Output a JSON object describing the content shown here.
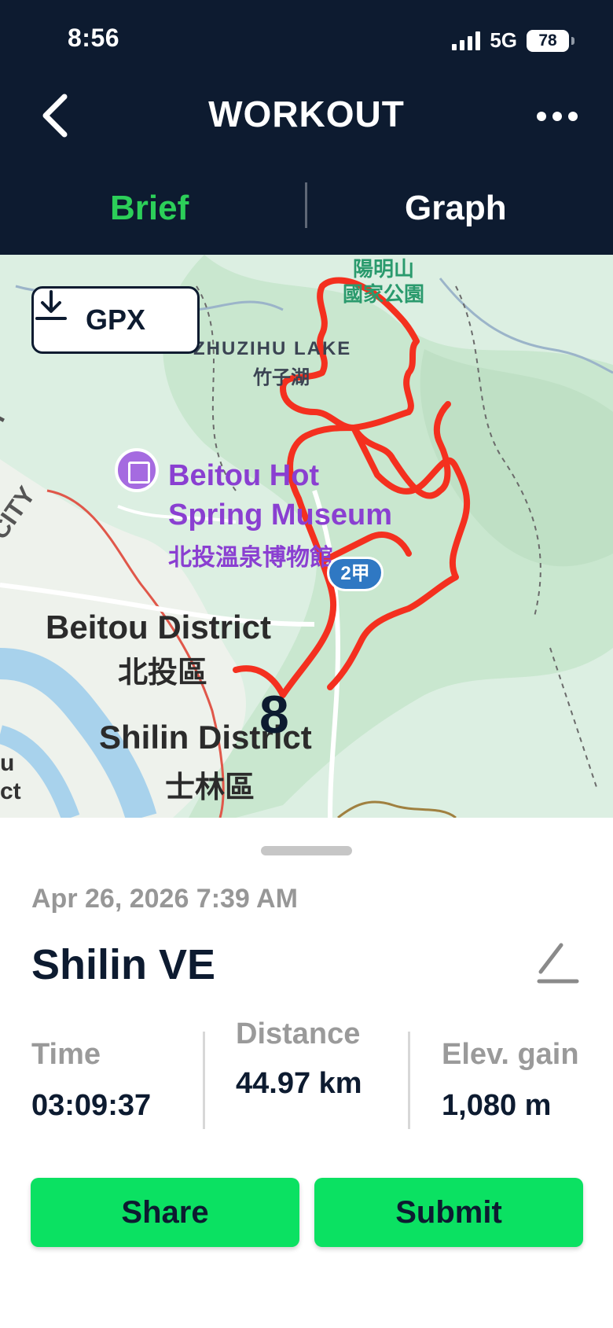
{
  "status_bar": {
    "time": "8:56",
    "network": "5G",
    "battery": "78"
  },
  "header": {
    "title": "WORKOUT"
  },
  "tabs": [
    {
      "label": "Brief",
      "active": true
    },
    {
      "label": "Graph",
      "active": false
    }
  ],
  "map": {
    "gpx_button_label": "GPX",
    "labels": {
      "park": "陽明山\n國家公園",
      "lake_en": "ZHUZIHU LAKE",
      "lake_zh": "竹子湖",
      "museum_en": "Beitou Hot\nSpring Museum",
      "museum_zh": "北投溫泉博物館",
      "beitou_en": "Beitou District",
      "beitou_zh": "北投區",
      "shilin_en": "Shilin District",
      "shilin_zh": "士林區",
      "city_1": "ITY",
      "city_2": "CITY",
      "edge_1": "u",
      "edge_2": "ct"
    },
    "route_badge": "2甲",
    "lap_marker": "8",
    "route_color": "#f4301f"
  },
  "workout": {
    "date": "Apr 26, 2026 7:39 AM",
    "name": "Shilin VE",
    "stats": [
      {
        "label": "Time",
        "value": "03:09:37"
      },
      {
        "label": "Distance",
        "value": "44.97 km"
      },
      {
        "label": "Elev. gain",
        "value": "1,080 m"
      }
    ]
  },
  "actions": {
    "share_label": "Share",
    "submit_label": "Submit"
  },
  "colors": {
    "header_bg": "#0d1b30",
    "accent_green": "#2ccf59",
    "button_green": "#0be162"
  },
  "icons": {
    "back": "chevron-left-icon",
    "more": "more-horizontal-icon",
    "download": "download-icon",
    "edit": "pencil-icon"
  }
}
